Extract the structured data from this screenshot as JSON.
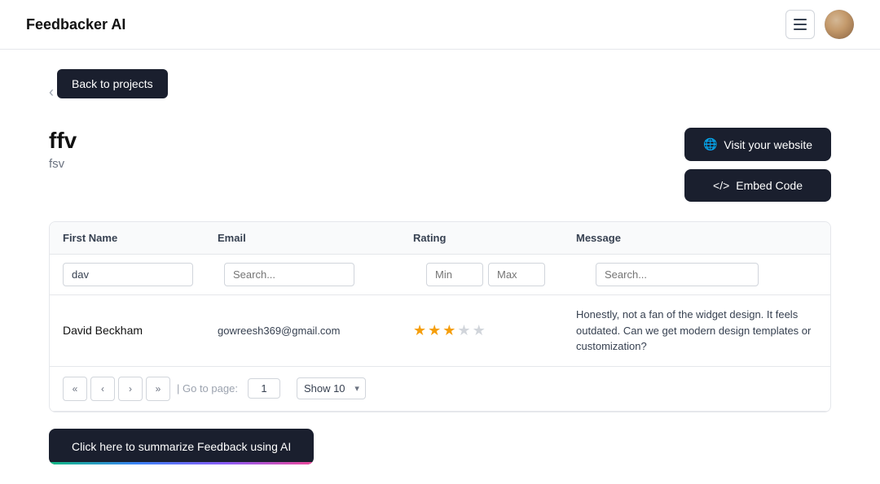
{
  "header": {
    "logo": "Feedbacker AI"
  },
  "back_button": {
    "label": "Back to projects"
  },
  "project": {
    "title": "ffv",
    "subtitle": "fsv"
  },
  "actions": {
    "visit_label": "Visit your website",
    "embed_label": "Embed Code"
  },
  "table": {
    "columns": [
      "First Name",
      "Email",
      "Rating",
      "Message"
    ],
    "filters": {
      "first_name_value": "dav",
      "email_placeholder": "Search...",
      "rating_min_placeholder": "Min",
      "rating_max_placeholder": "Max",
      "message_placeholder": "Search..."
    },
    "rows": [
      {
        "first_name": "David Beckham",
        "email": "gowreesh369@gmail.com",
        "rating": 3,
        "max_rating": 5,
        "message": "Honestly, not a fan of the widget design. It feels outdated. Can we get modern design templates or customization?"
      }
    ]
  },
  "pagination": {
    "goto_label": "| Go to page:",
    "current_page": "1",
    "show_label": "Show 10"
  },
  "ai_button": {
    "label": "Click here to summarize Feedback using AI"
  }
}
